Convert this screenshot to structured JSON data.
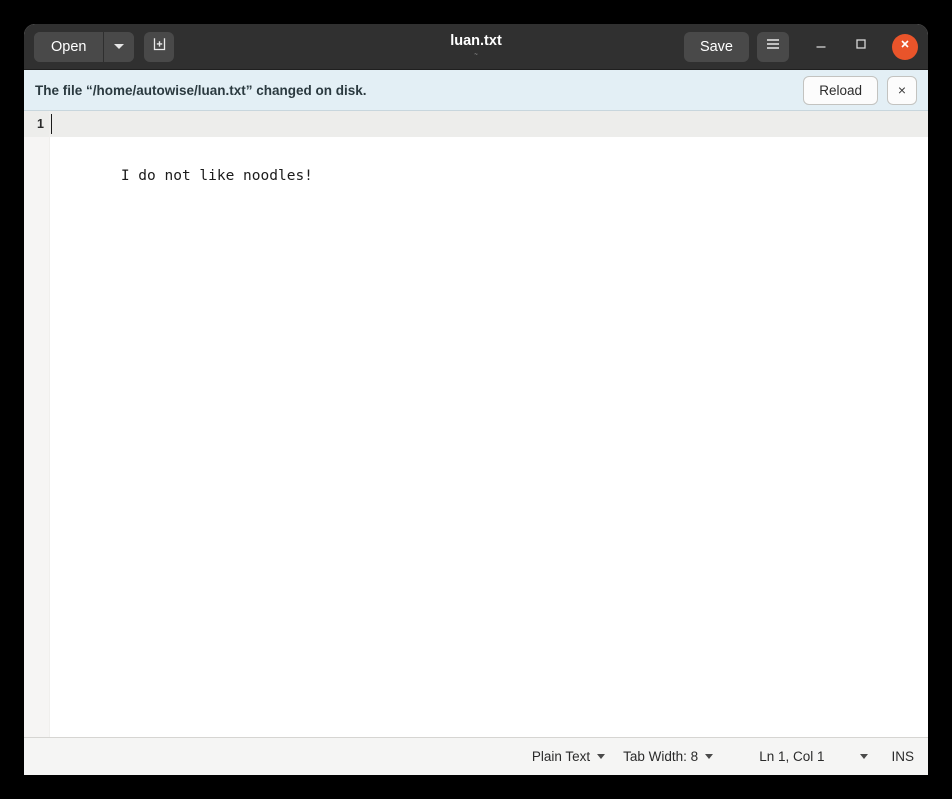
{
  "window": {
    "title": "luan.txt",
    "subtitle": "~",
    "header_bg": "#303030",
    "close_color": "#e9542a"
  },
  "headerbar": {
    "open_label": "Open",
    "open_dropdown_icon": "chevron-down-icon",
    "new_document_icon": "new-document-icon",
    "save_label": "Save",
    "menu_icon": "hamburger-menu-icon",
    "minimize_icon": "minimize-icon",
    "maximize_icon": "maximize-icon",
    "close_icon": "close-icon"
  },
  "infobar": {
    "message": "The file “/home/autowise/luan.txt” changed on disk.",
    "reload_label": "Reload",
    "dismiss_label": "×",
    "background": "#e3eff5"
  },
  "editor": {
    "lines": [
      {
        "number": "1",
        "text": "I do not like noodles!"
      }
    ],
    "cursor": {
      "line": 1,
      "column": 1
    }
  },
  "statusbar": {
    "language": "Plain Text",
    "tab_width": "Tab Width: 8",
    "position": "Ln 1, Col 1",
    "overwrite_mode": "INS",
    "language_caret_icon": "chevron-down-icon",
    "tabwidth_caret_icon": "chevron-down-icon",
    "position_caret_icon": "chevron-down-icon"
  }
}
